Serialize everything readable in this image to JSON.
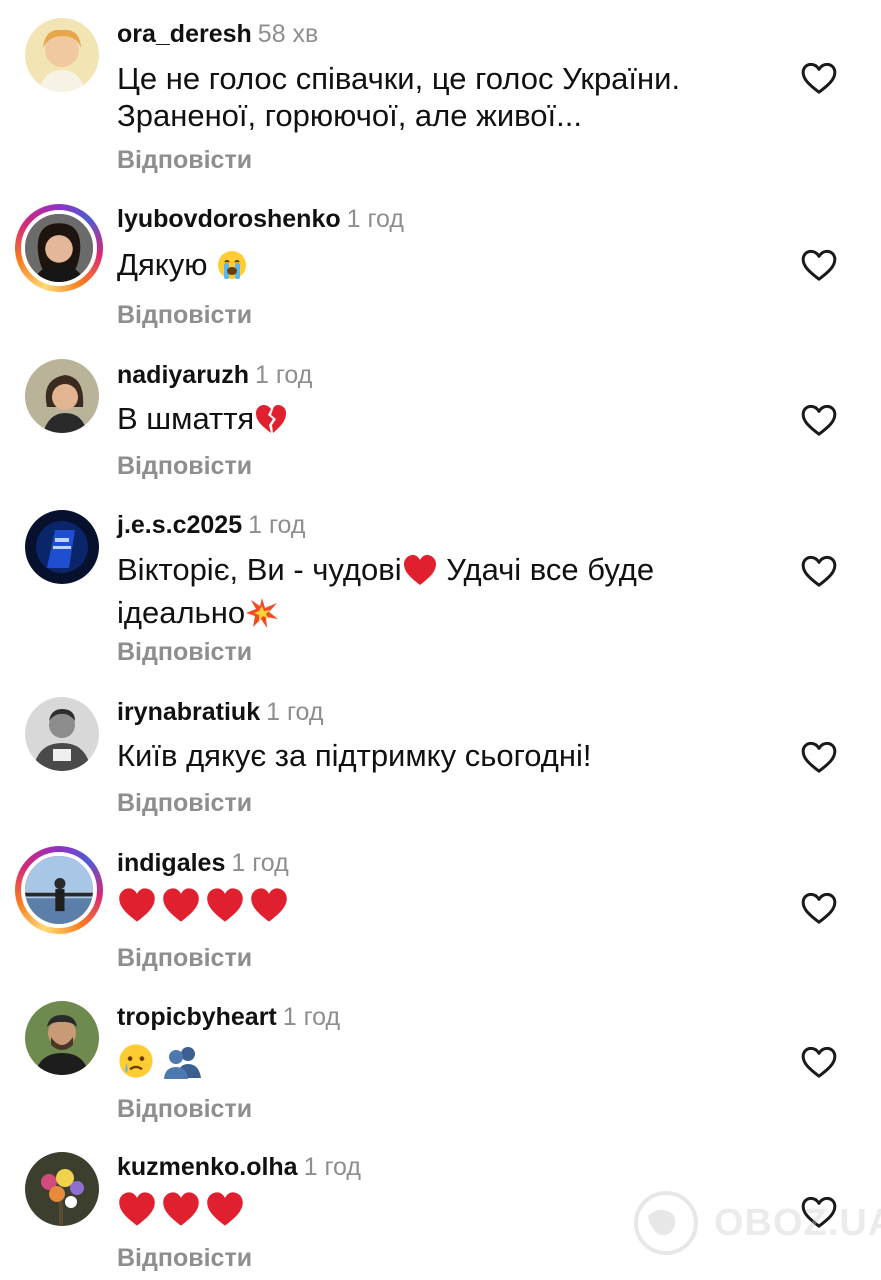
{
  "reply_label": "Відповісти",
  "comments": [
    {
      "username": "ora_deresh",
      "time": "58 хв",
      "text_lines": [
        "Це не голос співачки, це голос України.",
        "Зраненої, горюючої, але живої..."
      ]
    },
    {
      "username": "lyubovdoroshenko",
      "time": "1 год",
      "text": "Дякую",
      "emoji": "loudly-crying-face"
    },
    {
      "username": "nadiyaruzh",
      "time": "1 год",
      "text": "В шмаття",
      "emoji": "broken-heart"
    },
    {
      "username": "j.e.s.c2025",
      "time": "1 год",
      "text_part1": "Вікторіє, Ви - чудові",
      "text_part2": " Удачі все буде",
      "text_part3": "ідеально",
      "emojis": [
        "red-heart",
        "collision"
      ]
    },
    {
      "username": "irynabratiuk",
      "time": "1 год",
      "text": "Київ дякує за підтримку сьогодні!"
    },
    {
      "username": "indigales",
      "time": "1 год",
      "emojis": [
        "red-heart",
        "red-heart",
        "red-heart",
        "red-heart"
      ]
    },
    {
      "username": "tropicbyheart",
      "time": "1 год",
      "emojis": [
        "crying-face",
        "busts-in-silhouette"
      ]
    },
    {
      "username": "kuzmenko.olha",
      "time": "1 год",
      "emojis": [
        "red-heart",
        "red-heart",
        "red-heart"
      ]
    }
  ],
  "watermark": "OBOZ.UA",
  "colors": {
    "text": "#111111",
    "secondary": "#8e8e8e",
    "heart_emoji": "#e0202e"
  }
}
